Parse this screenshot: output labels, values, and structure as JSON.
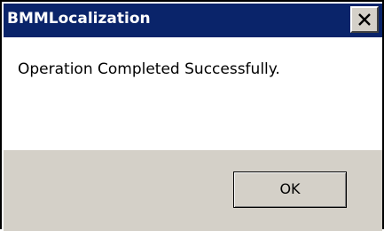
{
  "window": {
    "title": "BMMLocalization",
    "close_icon": "close-icon",
    "title_bar_color": "#0a246a"
  },
  "dialog": {
    "message": "Operation Completed Successfully.",
    "ok_label": "OK"
  },
  "colors": {
    "footer_background": "#d4d0c8"
  }
}
